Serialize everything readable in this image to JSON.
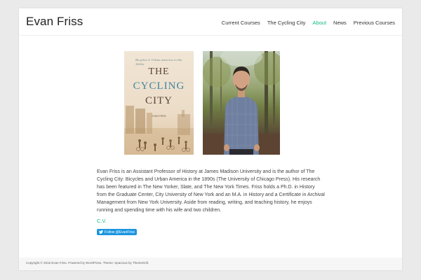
{
  "site": {
    "title": "Evan Friss"
  },
  "nav": {
    "items": [
      {
        "label": "Current Courses",
        "active": false
      },
      {
        "label": "The Cycling City",
        "active": false
      },
      {
        "label": "About",
        "active": true
      },
      {
        "label": "News",
        "active": false
      },
      {
        "label": "Previous Courses",
        "active": false
      }
    ]
  },
  "book": {
    "subtitle": "Bicycles & Urban America in the 1890s",
    "title_line1": "THE",
    "title_line2": "CYCLING",
    "title_line3": "CITY",
    "author": "EVAN FRISS"
  },
  "bio": {
    "text": "Evan Friss is an Assistant Professor of History at James Madison University and is the author of The Cycling City: Bicycles and Urban America in the 1890s (The University of Chicago Press).  His research has been featured in The New Yorker, Slate, and The New York Times. Friss holds a Ph.D. in History from the Graduate Center, City University of New York and an M.A. in History and a Certificate in Archival Management from New York University.  Aside from reading, writing, and teaching history, he enjoys running and spending time with his wife and two children."
  },
  "cv": {
    "label": "C.V."
  },
  "twitter": {
    "follow_label": "Follow @EvanFriss"
  },
  "footer": {
    "copyright": "Copyright © 2016 Evan Friss. Powered by WordPress. Theme: Spacious by ThemeGrill."
  },
  "colors": {
    "accent": "#0fbe7c",
    "twitter": "#1b95e0"
  },
  "icons": {
    "twitter": "twitter-bird-icon"
  }
}
